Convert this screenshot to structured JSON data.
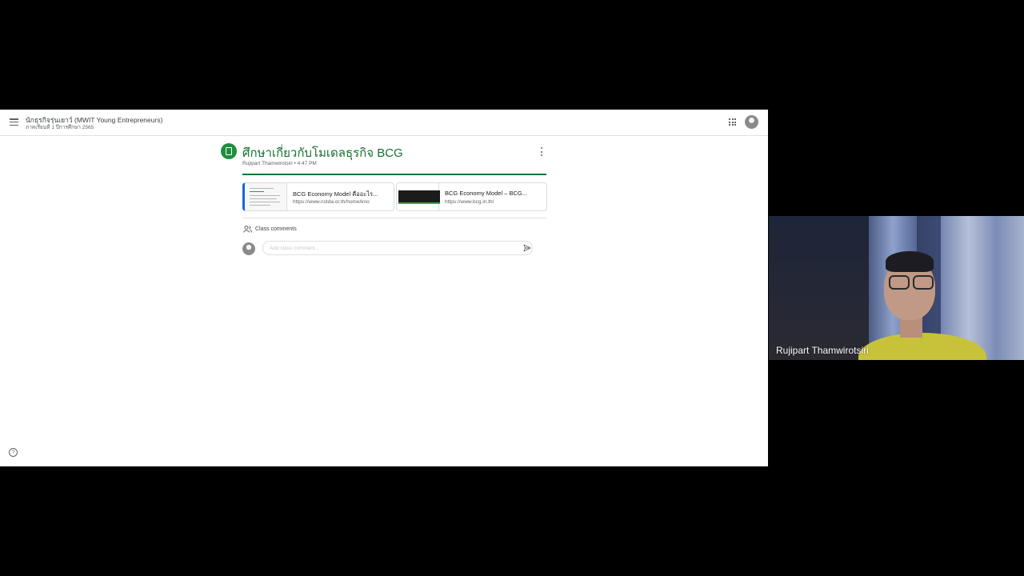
{
  "classroom": {
    "class_name": "นักธุรกิจรุ่นเยาว์ (MWIT Young Entrepreneurs)",
    "class_section": "ภาคเรียนที่ 1 ปีการศึกษา 2565",
    "icons": {
      "menu": "hamburger-menu-icon",
      "apps": "apps-grid-icon",
      "account": "account-avatar"
    }
  },
  "post": {
    "title": "ศึกษาเกี่ยวกับโมเดลธุรกิจ BCG",
    "author": "Rujipart Thamwirotsiri",
    "separator": "•",
    "time": "4:47 PM",
    "accent_color": "#137333",
    "attachments": [
      {
        "title": "BCG Economy Model คืออะไร...",
        "url": "https://www.nstda.or.th/home/kno"
      },
      {
        "title": "BCG Economy Model – BCG...",
        "url": "https://www.bcg.in.th/"
      }
    ]
  },
  "comments": {
    "label": "Class comments",
    "placeholder": "Add class comment..."
  },
  "video_tile": {
    "participant_name": "Rujipart Thamwirotsiri"
  }
}
